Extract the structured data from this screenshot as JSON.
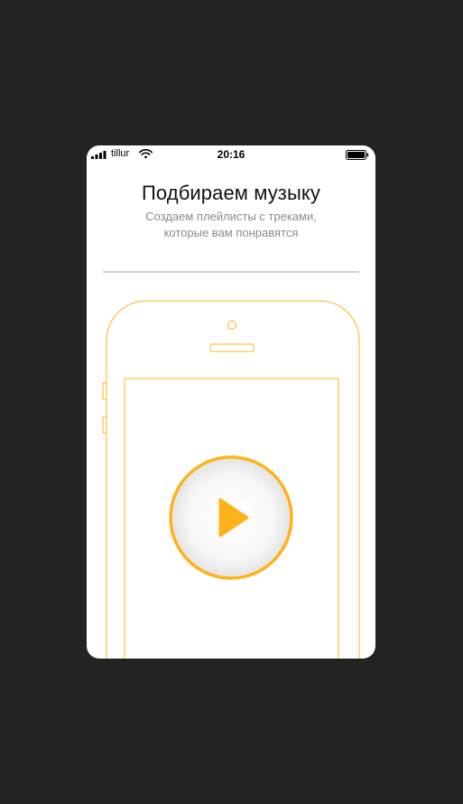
{
  "status_bar": {
    "carrier": "tillur",
    "time": "20:16"
  },
  "onboarding": {
    "title": "Подбираем музыку",
    "subtitle": "Создаем плейлисты с треками, которые вам понравятся"
  },
  "colors": {
    "accent": "#FFB31A",
    "background": "#232323",
    "card": "#FFFFFF",
    "subtitle": "#8A8A8A",
    "divider": "#D0D0D0"
  },
  "icons": {
    "signal": "signal-bars-icon",
    "wifi": "wifi-icon",
    "battery": "battery-icon",
    "play": "play-icon"
  }
}
